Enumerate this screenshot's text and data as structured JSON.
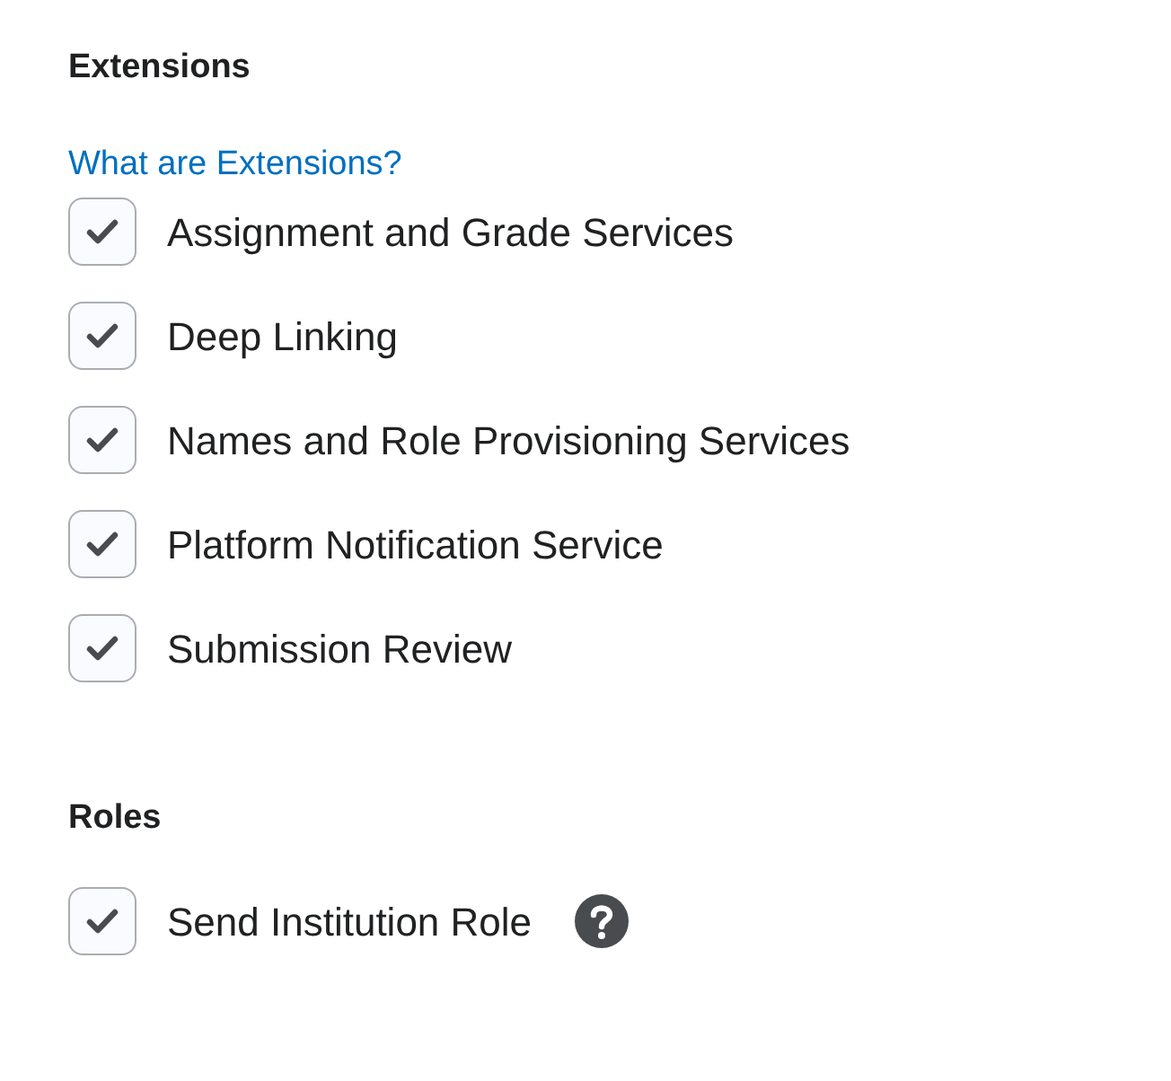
{
  "sections": [
    {
      "heading": "Extensions",
      "link": "What are Extensions?",
      "items": [
        {
          "label": "Assignment and Grade Services",
          "checked": true,
          "help": false
        },
        {
          "label": "Deep Linking",
          "checked": true,
          "help": false
        },
        {
          "label": "Names and Role Provisioning Services",
          "checked": true,
          "help": false
        },
        {
          "label": "Platform Notification Service",
          "checked": true,
          "help": false
        },
        {
          "label": "Submission Review",
          "checked": true,
          "help": false
        }
      ]
    },
    {
      "heading": "Roles",
      "items": [
        {
          "label": "Send Institution Role",
          "checked": true,
          "help": true
        }
      ]
    }
  ]
}
